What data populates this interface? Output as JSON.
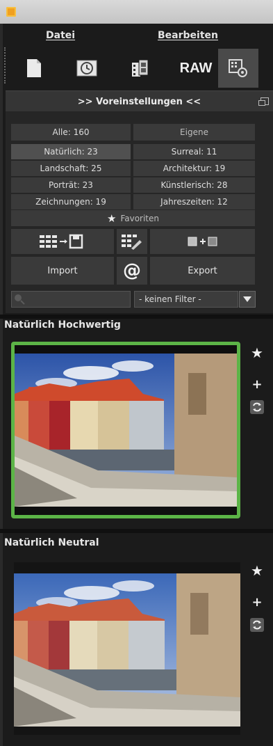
{
  "menu": {
    "datei": "Datei",
    "bearbeiten": "Bearbeiten"
  },
  "toolbar": {
    "raw_label": "RAW",
    "active_tool": "settings"
  },
  "section": {
    "title": ">> Voreinstellungen <<"
  },
  "categories": {
    "alle": "Alle: 160",
    "eigene": "Eigene",
    "natuerlich": "Natürlich: 23",
    "surreal": "Surreal: 11",
    "landschaft": "Landschaft: 25",
    "architektur": "Architektur: 19",
    "portraet": "Porträt: 23",
    "kuenstlerisch": "Künstlerisch: 28",
    "zeichnungen": "Zeichnungen: 19",
    "jahreszeiten": "Jahreszeiten: 12",
    "favoriten": "Favoriten"
  },
  "actions": {
    "import": "Import",
    "export": "Export",
    "at": "@"
  },
  "filter": {
    "selected": "- keinen Filter -"
  },
  "presets": [
    {
      "title": "Natürlich Hochwertig",
      "selected": true
    },
    {
      "title": "Natürlich Neutral",
      "selected": false
    }
  ],
  "colors": {
    "accent_green": "#5cb447",
    "panel": "#262626",
    "button": "#3a3a3a"
  }
}
